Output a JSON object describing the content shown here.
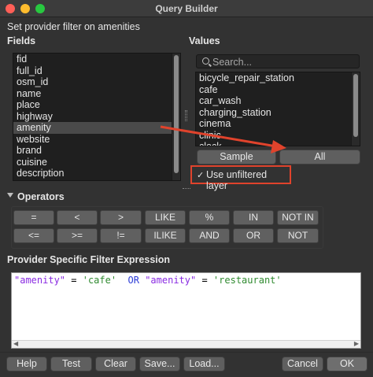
{
  "window": {
    "title": "Query Builder"
  },
  "header": {
    "text": "Set provider filter on amenities"
  },
  "fields": {
    "heading": "Fields",
    "items": [
      "fid",
      "full_id",
      "osm_id",
      "name",
      "place",
      "highway",
      "amenity",
      "website",
      "brand",
      "cuisine",
      "description"
    ],
    "selected": "amenity"
  },
  "values": {
    "heading": "Values",
    "search_placeholder": "Search...",
    "items": [
      "bicycle_repair_station",
      "cafe",
      "car_wash",
      "charging_station",
      "cinema",
      "clinic",
      "clock"
    ],
    "sample_label": "Sample",
    "all_label": "All",
    "use_unfiltered_label": "Use unfiltered layer",
    "use_unfiltered_checked": true
  },
  "operators": {
    "heading": "Operators",
    "row1": [
      "=",
      "<",
      ">",
      "LIKE",
      "%",
      "IN",
      "NOT IN"
    ],
    "row2": [
      "<=",
      ">=",
      "!=",
      "ILIKE",
      "AND",
      "OR",
      "NOT"
    ]
  },
  "expression": {
    "heading": "Provider Specific Filter Expression",
    "tokens": [
      {
        "text": "\"amenity\"",
        "kind": "field"
      },
      {
        "text": " = ",
        "kind": "op"
      },
      {
        "text": "'cafe'",
        "kind": "str"
      },
      {
        "text": "  OR ",
        "kind": "kw"
      },
      {
        "text": "\"amenity\"",
        "kind": "field"
      },
      {
        "text": " = ",
        "kind": "op"
      },
      {
        "text": "'restaurant'",
        "kind": "str"
      }
    ]
  },
  "footer": {
    "help": "Help",
    "test": "Test",
    "clear": "Clear",
    "save": "Save...",
    "load": "Load...",
    "cancel": "Cancel",
    "ok": "OK"
  },
  "colors": {
    "highlight": "#e0432c",
    "background": "#323232"
  }
}
